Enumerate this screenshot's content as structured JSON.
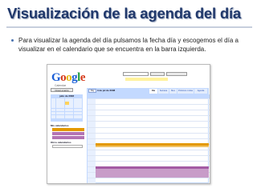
{
  "slide": {
    "title": "Visualización de la agenda del día",
    "bullet": "Para visualizar la agenda del día pulsamos la fecha día y escogemos el día a visualizar en el calendario que se encuentra en la barra izquierda."
  },
  "calendar_ui": {
    "logo_letters": [
      "G",
      "o",
      "o",
      "g",
      "l",
      "e"
    ],
    "logo_colors": [
      "#1a5ed6",
      "#d63a1a",
      "#e6b800",
      "#1a5ed6",
      "#1f9c3c",
      "#d63a1a"
    ],
    "logo_sub": "Calendar",
    "account_links": "",
    "search_button": "",
    "search_public_button": "",
    "search_link": "",
    "notice": "",
    "create_event": "Crear evento",
    "mini_calendar_title": "julio de 2008",
    "my_calendars": "Mis calendarios",
    "other_calendars": "Otros calendarios",
    "calendar_colors": [
      "#e39800",
      "#b373b3"
    ],
    "toolbar": {
      "today": "Hoy",
      "date": "3 de jul de 2008",
      "tabs": [
        "Día",
        "Semana",
        "Mes",
        "Próximos 4 días",
        "Agenda"
      ]
    },
    "day_header": "",
    "hours": [
      "",
      "",
      "",
      "",
      "",
      "",
      "",
      "",
      "",
      "",
      "",
      "",
      "",
      "",
      ""
    ],
    "events": [
      {
        "title": "",
        "color": "#e39800"
      },
      {
        "title": "",
        "color": "#b373b3"
      }
    ]
  }
}
